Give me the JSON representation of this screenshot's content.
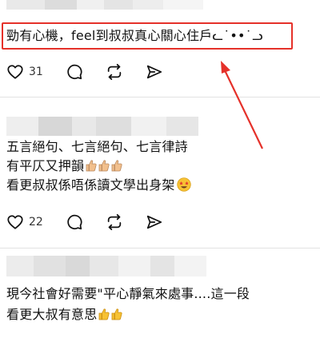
{
  "colors": {
    "highlight": "#e5312a",
    "text": "#111111",
    "divider": "#e2e2e2",
    "thumb_light": "#f2c08d",
    "thumb_yellow": "#f7c234"
  },
  "comments": [
    {
      "text_lines": [
        "勁有心機，feel到叔叔真心關心住戶ᓚ˙••˙ᓗ"
      ],
      "likes": "31",
      "icons": [
        "heart-icon",
        "comment-icon",
        "repost-icon",
        "share-icon"
      ]
    },
    {
      "text_lines": [
        "五言絕句、七言絕句、七言律詩",
        "有平仄又押韻",
        "看更叔叔係唔係讀文學出身架"
      ],
      "likes": "22",
      "icons": [
        "heart-icon",
        "comment-icon",
        "repost-icon",
        "share-icon"
      ]
    },
    {
      "text_lines": [
        "現今社會好需要\"平心靜氣來處事....這一段",
        "看更大叔有意思"
      ]
    }
  ]
}
